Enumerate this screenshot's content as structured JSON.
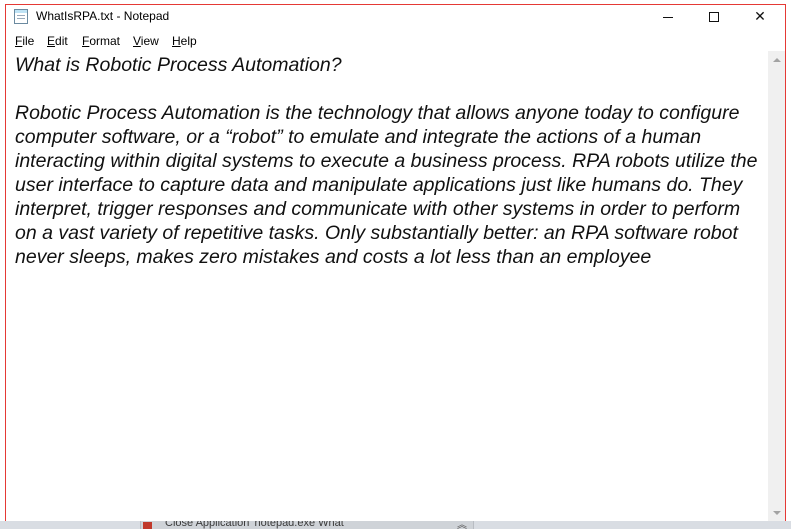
{
  "window": {
    "title": "WhatIsRPA.txt - Notepad",
    "icon": "notepad-icon",
    "controls": {
      "minimize": "minimize-icon",
      "maximize": "maximize-icon",
      "close": "close-icon",
      "close_glyph": "✕"
    },
    "highlight_border_color": "#e53935"
  },
  "menu": {
    "file": {
      "accel": "F",
      "rest": "ile"
    },
    "edit": {
      "accel": "E",
      "rest": "dit"
    },
    "format": {
      "accel": "F",
      "rest": "ormat"
    },
    "view": {
      "accel": "V",
      "rest": "iew"
    },
    "help": {
      "accel": "H",
      "rest": "elp"
    }
  },
  "document": {
    "text": "What is Robotic Process Automation?\n\nRobotic Process Automation is the technology that allows anyone today to configure computer software, or a “robot” to emulate and integrate the actions of a human interacting within digital systems to execute a business process. RPA robots utilize the user interface to capture data and manipulate applications just like humans do. They interpret, trigger responses and communicate with other systems in order to perform on a vast variety of repetitive tasks. Only substantially better: an RPA software robot never sleeps, makes zero mistakes and costs a lot less than an employee"
  },
  "background_task": {
    "label": "Close Application 'notepad.exe What'",
    "chevron": "︽"
  }
}
